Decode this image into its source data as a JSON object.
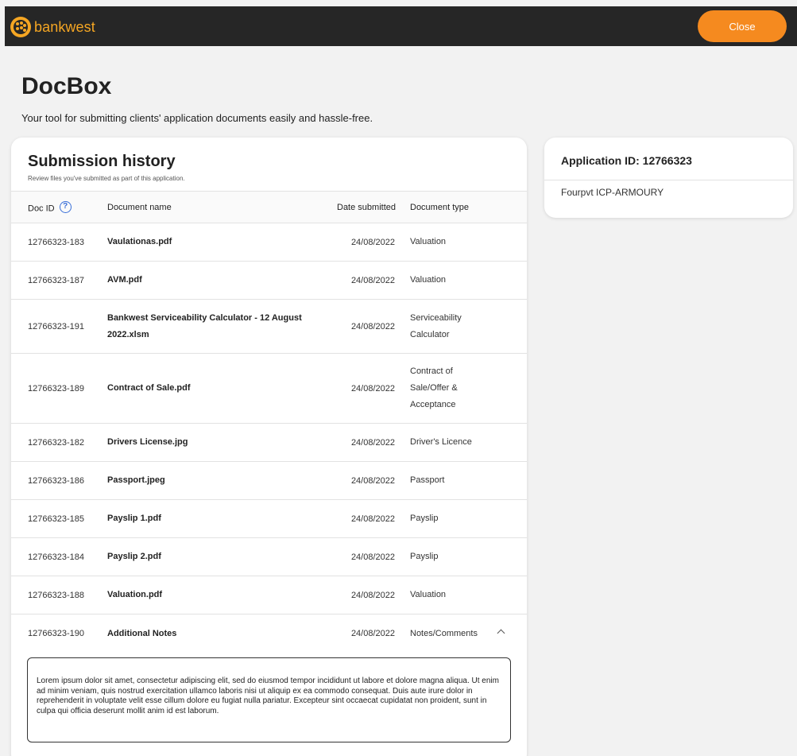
{
  "header": {
    "brand": "bankwest",
    "close_label": "Close",
    "colors": {
      "bar": "#262626",
      "brand": "#f5a623",
      "button": "#f58a1f"
    }
  },
  "page": {
    "title": "DocBox",
    "subtitle": "Your tool for submitting clients' application documents easily and hassle-free."
  },
  "history": {
    "title": "Submission history",
    "subtitle": "Review files you've submitted as part of this application.",
    "columns": {
      "doc_id": "Doc ID",
      "doc_name": "Document name",
      "date": "Date submitted",
      "type": "Document type"
    },
    "rows": [
      {
        "id": "12766323-183",
        "name": "Vaulationas.pdf",
        "date": "24/08/2022",
        "type": "Valuation"
      },
      {
        "id": "12766323-187",
        "name": "AVM.pdf",
        "date": "24/08/2022",
        "type": "Valuation"
      },
      {
        "id": "12766323-191",
        "name": "Bankwest Serviceability Calculator - 12 August 2022.xlsm",
        "date": "24/08/2022",
        "type": "Serviceability Calculator"
      },
      {
        "id": "12766323-189",
        "name": "Contract of Sale.pdf",
        "date": "24/08/2022",
        "type": "Contract of Sale/Offer & Acceptance"
      },
      {
        "id": "12766323-182",
        "name": "Drivers License.jpg",
        "date": "24/08/2022",
        "type": "Driver's Licence"
      },
      {
        "id": "12766323-186",
        "name": "Passport.jpeg",
        "date": "24/08/2022",
        "type": "Passport"
      },
      {
        "id": "12766323-185",
        "name": "Payslip 1.pdf",
        "date": "24/08/2022",
        "type": "Payslip"
      },
      {
        "id": "12766323-184",
        "name": "Payslip 2.pdf",
        "date": "24/08/2022",
        "type": "Payslip"
      },
      {
        "id": "12766323-188",
        "name": "Valuation.pdf",
        "date": "24/08/2022",
        "type": "Valuation"
      },
      {
        "id": "12766323-190",
        "name": "Additional Notes",
        "date": "24/08/2022",
        "type": "Notes/Comments"
      }
    ],
    "notes_text": "Lorem ipsum dolor sit amet, consectetur adipiscing elit, sed do eiusmod tempor incididunt ut labore et dolore magna aliqua. Ut enim ad minim veniam, quis nostrud exercitation ullamco laboris nisi ut aliquip ex ea commodo consequat. Duis aute irure dolor in reprehenderit in voluptate velit esse cillum dolore eu fugiat nulla pariatur. Excepteur sint occaecat cupidatat non proident, sunt in culpa qui officia deserunt mollit anim id est laborum."
  },
  "application": {
    "title": "Application ID: 12766323",
    "name": "Fourpvt ICP-ARMOURY"
  }
}
